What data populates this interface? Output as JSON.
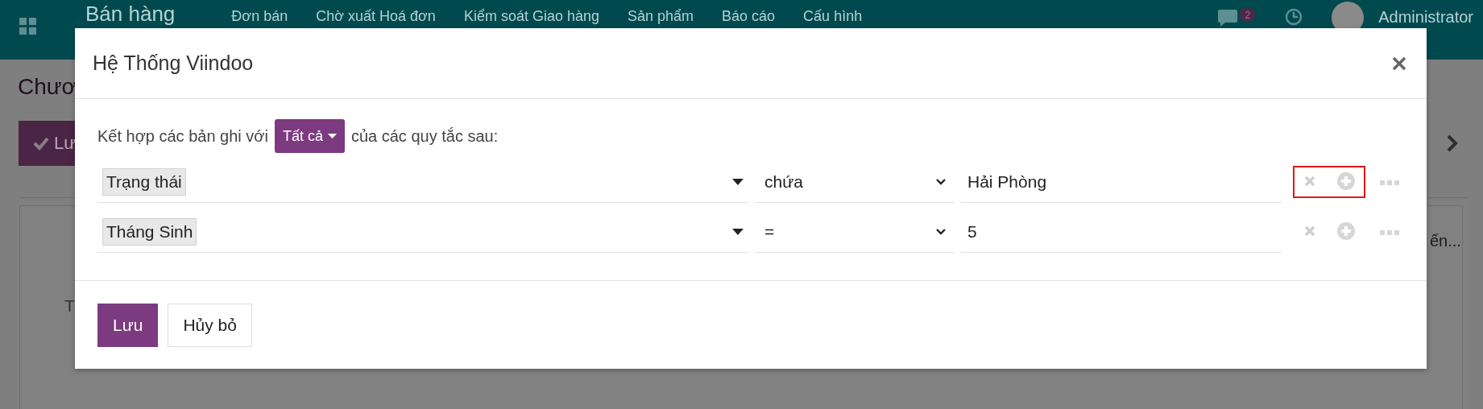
{
  "navbar": {
    "app_title": "Bán hàng",
    "menu": [
      "Đơn bán",
      "Chờ xuất Hoá đơn",
      "Kiểm soát Giao hàng",
      "Sản phẩm",
      "Báo cáo",
      "Cấu hình"
    ],
    "messages_count": "2",
    "user": "Administrator"
  },
  "background": {
    "title": "Chươ",
    "save_button": "Lư",
    "field_label": "T",
    "tab_label": "ến..."
  },
  "dialog": {
    "title": "Hệ Thống Viindoo",
    "intro_before": "Kết hợp các bản ghi với",
    "match_mode": "Tất cả",
    "intro_after": "của các quy tắc sau:",
    "rules": [
      {
        "field": "Trạng thái",
        "operator": "chứa",
        "value": "Hải Phòng",
        "highlighted": true
      },
      {
        "field": "Tháng Sinh",
        "operator": "=",
        "value": "5",
        "highlighted": false
      }
    ],
    "buttons": [
      {
        "label": "Lưu",
        "kind": "primary"
      },
      {
        "label": "Hủy bỏ",
        "kind": "secondary"
      }
    ]
  }
}
